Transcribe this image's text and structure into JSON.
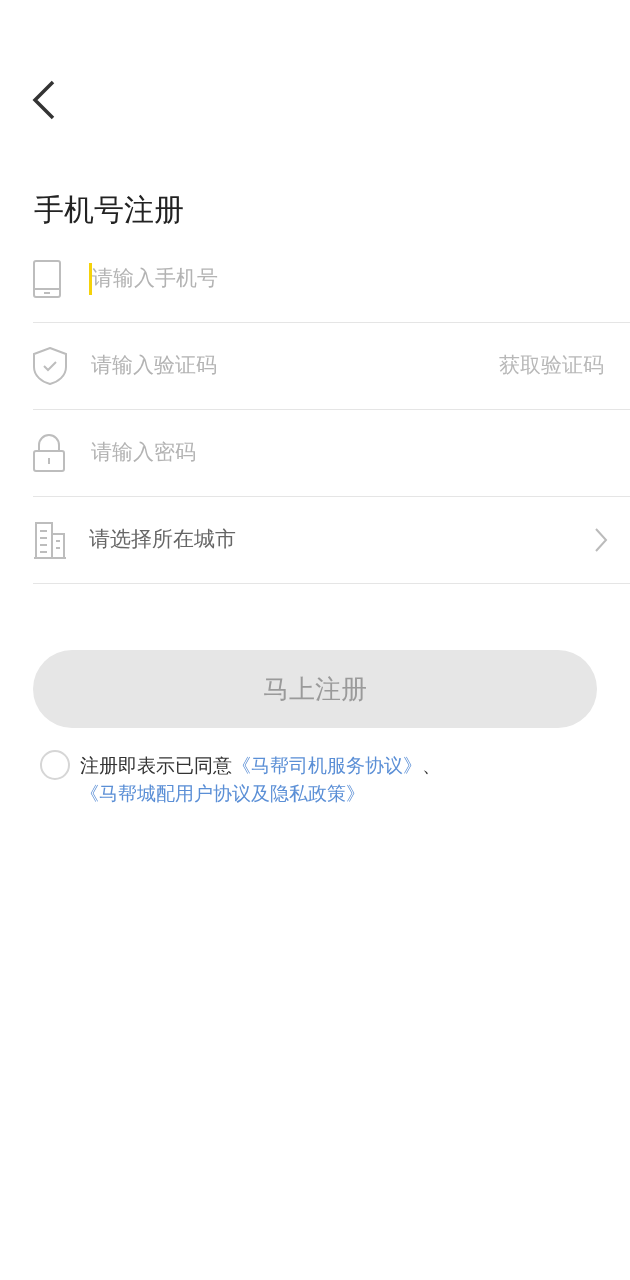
{
  "title": "手机号注册",
  "fields": [
    {
      "kind": "input",
      "placeholder": "请输入手机号",
      "focused": true
    },
    {
      "kind": "input",
      "placeholder": "请输入验证码",
      "action": "获取验证码",
      "focused": false
    },
    {
      "kind": "input",
      "placeholder": "请输入密码",
      "focused": false
    },
    {
      "kind": "select",
      "label": "请选择所在城市"
    }
  ],
  "submit": {
    "label": "马上注册",
    "disabled": true
  },
  "agreement": {
    "checked": false,
    "text": "注册即表示已同意",
    "links": [
      "《马帮司机服务协议》",
      "《马帮城配用户协议及隐私政策》"
    ],
    "separator": "、"
  }
}
